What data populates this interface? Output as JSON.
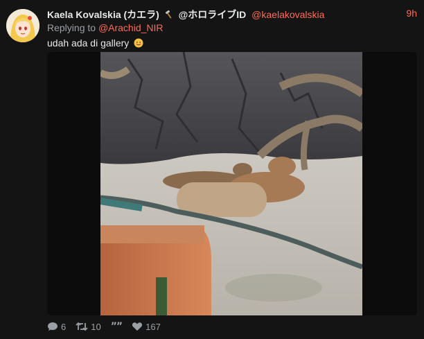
{
  "tweet": {
    "author_name": "Kaela Kovalskia (カエラ)",
    "author_group": "@ホロライブID",
    "handle": "@kaelakovalskia",
    "time": "9h",
    "reply_prefix": "Replying to",
    "reply_mention": "@Arachid_NIR",
    "text": "udah ada di gallery",
    "emoji_icon": "smiling-face-icon",
    "name_icon": "hammer-icon",
    "media_alt": "Capybaras resting by a log in a zoo enclosure",
    "stats": {
      "replies": "6",
      "retweets": "10",
      "quote_glyph": "””",
      "likes": "167"
    }
  },
  "colors": {
    "background": "#141414",
    "accent": "#ff6b57",
    "muted": "#9aa0a6",
    "text": "#e7e9ea"
  }
}
